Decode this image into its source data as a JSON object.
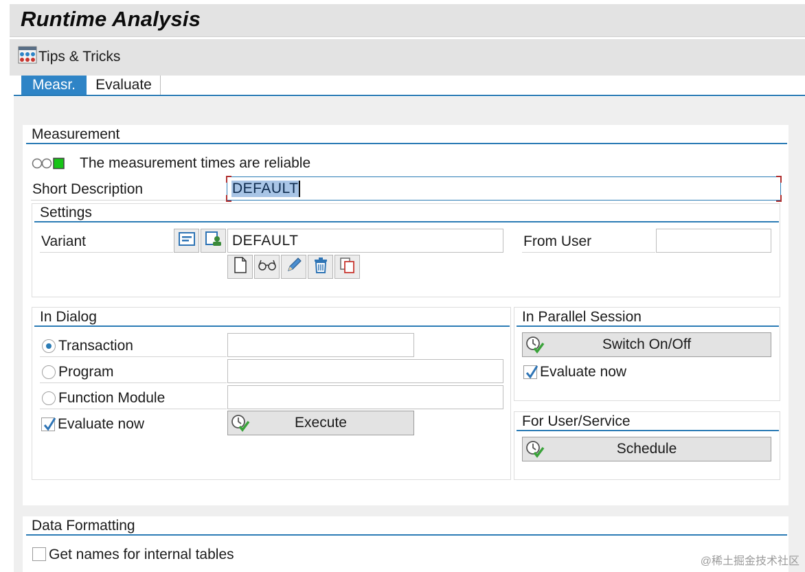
{
  "header": {
    "title": "Runtime Analysis"
  },
  "toolbar": {
    "tips_label": "Tips & Tricks"
  },
  "tabs": [
    {
      "label": "Measr.",
      "active": true
    },
    {
      "label": "Evaluate",
      "active": false
    }
  ],
  "measurement": {
    "section_title": "Measurement",
    "status_text": "The measurement times are reliable",
    "short_description_label": "Short Description",
    "short_description_value": "DEFAULT"
  },
  "settings": {
    "section_title": "Settings",
    "variant_label": "Variant",
    "variant_value": "DEFAULT",
    "from_user_label": "From User",
    "from_user_value": ""
  },
  "in_dialog": {
    "section_title": "In Dialog",
    "options": [
      {
        "label": "Transaction",
        "selected": true,
        "value": ""
      },
      {
        "label": "Program",
        "selected": false,
        "value": ""
      },
      {
        "label": "Function Module",
        "selected": false,
        "value": ""
      }
    ],
    "evaluate_now_label": "Evaluate now",
    "evaluate_now_checked": true,
    "execute_label": "Execute"
  },
  "parallel_session": {
    "section_title": "In Parallel Session",
    "switch_label": "Switch On/Off",
    "evaluate_now_label": "Evaluate now",
    "evaluate_now_checked": true
  },
  "user_service": {
    "section_title": "For User/Service",
    "schedule_label": "Schedule"
  },
  "data_formatting": {
    "section_title": "Data Formatting",
    "internal_tables_label": "Get names for internal tables",
    "internal_tables_checked": false
  },
  "watermark": "@稀土掘金技术社区",
  "colors": {
    "accent": "#2a7bb5",
    "active_tab": "#2e84c6",
    "status_green": "#17c417",
    "background": "#efefef"
  },
  "icons": [
    "tips-tricks-icon",
    "variant-display-icon",
    "variant-user-icon",
    "new-document-icon",
    "glasses-icon",
    "pencil-icon",
    "trash-icon",
    "copy-icon",
    "clock-check-icon",
    "checkmark-icon"
  ]
}
